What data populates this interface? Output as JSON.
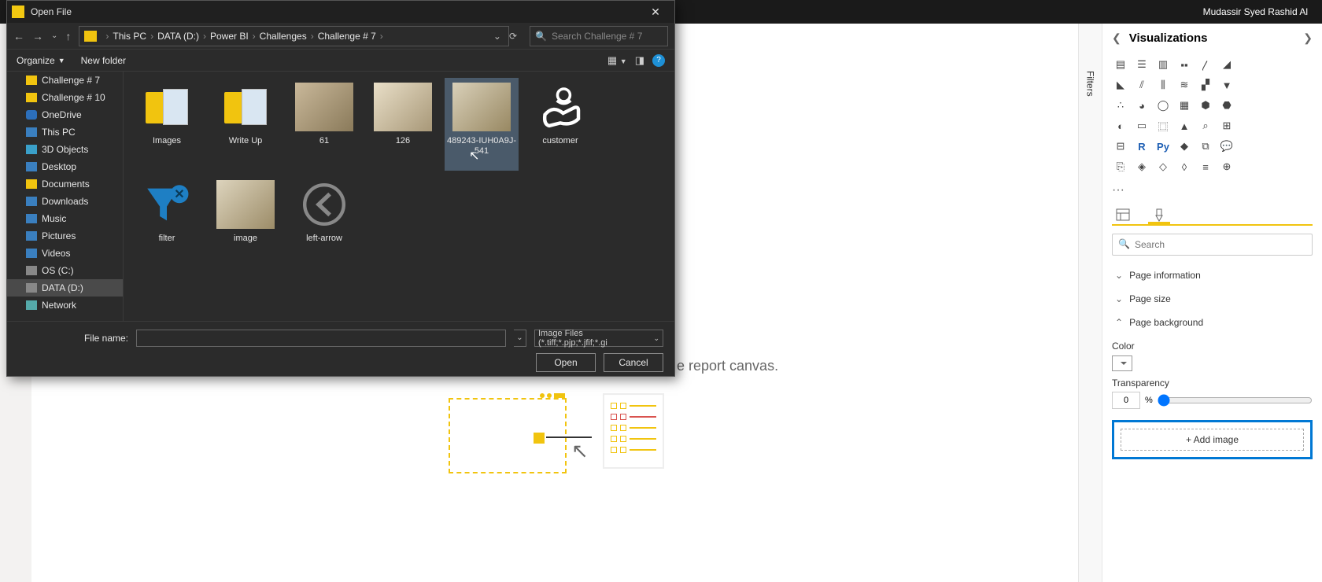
{
  "app": {
    "user": "Mudassir Syed Rashid Al"
  },
  "canvas": {
    "hint_suffix": "e report canvas."
  },
  "dialog": {
    "title": "Open File",
    "breadcrumb": [
      "This PC",
      "DATA (D:)",
      "Power BI",
      "Challenges",
      "Challenge # 7"
    ],
    "search_placeholder": "Search Challenge # 7",
    "toolbar": {
      "organize": "Organize",
      "new_folder": "New folder"
    },
    "tree": [
      {
        "label": "Challenge # 7",
        "icon": "folder"
      },
      {
        "label": "Challenge # 10",
        "icon": "folder"
      },
      {
        "label": "OneDrive",
        "icon": "cloud"
      },
      {
        "label": "This PC",
        "icon": "pc"
      },
      {
        "label": "3D Objects",
        "icon": "obj"
      },
      {
        "label": "Desktop",
        "icon": "pc"
      },
      {
        "label": "Documents",
        "icon": "folder"
      },
      {
        "label": "Downloads",
        "icon": "pc"
      },
      {
        "label": "Music",
        "icon": "pc"
      },
      {
        "label": "Pictures",
        "icon": "pc"
      },
      {
        "label": "Videos",
        "icon": "pc"
      },
      {
        "label": "OS (C:)",
        "icon": "drive"
      },
      {
        "label": "DATA (D:)",
        "icon": "drive",
        "selected": true
      },
      {
        "label": "Network",
        "icon": "net"
      }
    ],
    "files": [
      {
        "label": "Images",
        "kind": "folder"
      },
      {
        "label": "Write Up",
        "kind": "folder"
      },
      {
        "label": "61",
        "kind": "img"
      },
      {
        "label": "126",
        "kind": "img2"
      },
      {
        "label": "489243-IUH0A9J-541",
        "kind": "img3",
        "selected": true
      },
      {
        "label": "customer",
        "kind": "customer"
      },
      {
        "label": "filter",
        "kind": "filter"
      },
      {
        "label": "image",
        "kind": "img4"
      },
      {
        "label": "left-arrow",
        "kind": "arrow"
      }
    ],
    "footer": {
      "filename_label": "File name:",
      "filename_value": "",
      "type_filter": "Image Files (*.tiff;*.pjp;*.jfif;*.gi",
      "open": "Open",
      "cancel": "Cancel"
    }
  },
  "viz": {
    "filters_tab": "Filters",
    "title": "Visualizations",
    "search_placeholder": "Search",
    "icons": [
      "stacked-bar",
      "clustered-bar",
      "stacked-column",
      "clustered-column",
      "line",
      "area",
      "stacked-area",
      "line-stacked-column",
      "line-clustered-column",
      "ribbon",
      "waterfall",
      "funnel",
      "scatter",
      "pie",
      "donut",
      "treemap",
      "map",
      "filled-map",
      "gauge",
      "card",
      "multi-row-card",
      "kpi",
      "slicer",
      "table",
      "matrix",
      "r-visual",
      "python-visual",
      "key-influencers",
      "decomposition-tree",
      "qa",
      "paginated",
      "arcgis",
      "powerapps",
      "powerautomate",
      "smart-narrative",
      "get-more"
    ],
    "r_label": "R",
    "py_label": "Py",
    "sections": {
      "page_info": "Page information",
      "page_size": "Page size",
      "page_bg": "Page background"
    },
    "color_label": "Color",
    "transparency_label": "Transparency",
    "transparency_value": "0",
    "transparency_unit": "%",
    "add_image": "+ Add image"
  }
}
